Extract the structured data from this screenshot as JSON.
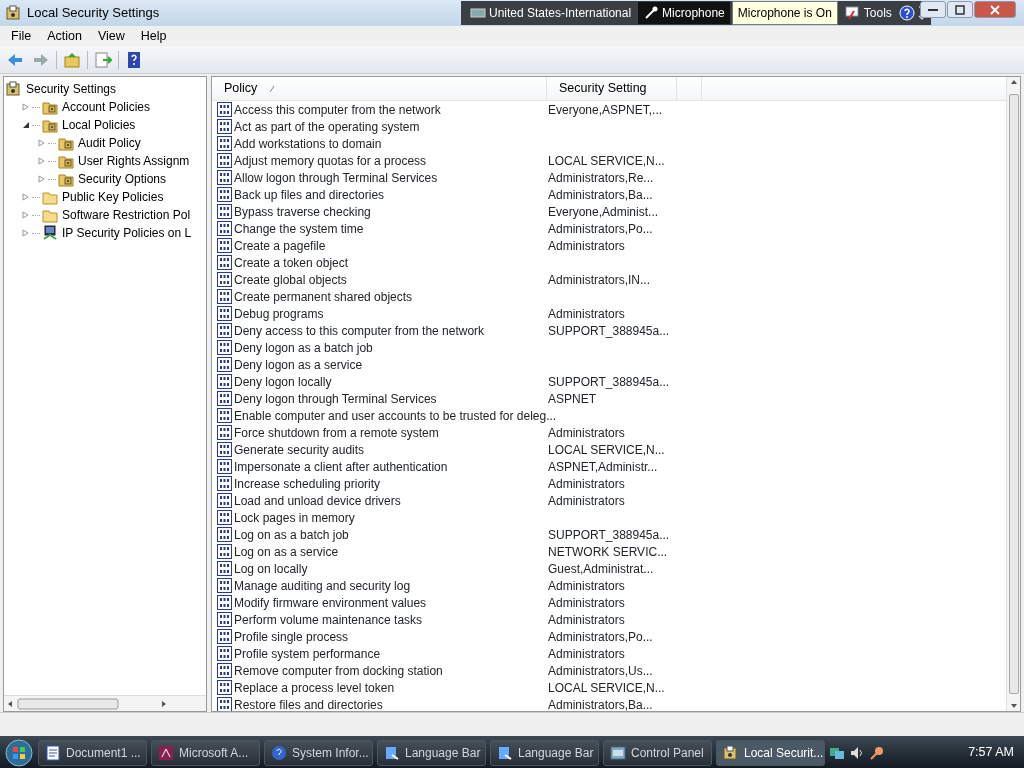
{
  "window": {
    "title": "Local Security Settings"
  },
  "language_bar": {
    "items": [
      {
        "label": "United States-International",
        "kind": "keyboard",
        "selected": false
      },
      {
        "label": "Microphone",
        "kind": "microphone",
        "selected": true
      },
      {
        "label": "Tools",
        "kind": "tools",
        "selected": false
      }
    ],
    "tooltip": "Microphone is On"
  },
  "menu": [
    "File",
    "Action",
    "View",
    "Help"
  ],
  "tree": [
    {
      "label": "Security Settings",
      "kind": "root",
      "children": [
        {
          "label": "Account Policies",
          "kind": "policy-folder",
          "expanded": false
        },
        {
          "label": "Local Policies",
          "kind": "policy-folder",
          "expanded": true,
          "children": [
            {
              "label": "Audit Policy",
              "kind": "policy-folder",
              "expanded": false
            },
            {
              "label": "User Rights Assignm",
              "kind": "policy-folder",
              "expanded": false
            },
            {
              "label": "Security Options",
              "kind": "policy-folder",
              "expanded": false
            }
          ]
        },
        {
          "label": "Public Key Policies",
          "kind": "folder",
          "expanded": false
        },
        {
          "label": "Software Restriction Pol",
          "kind": "folder",
          "expanded": false
        },
        {
          "label": "IP Security Policies on L",
          "kind": "network",
          "expanded": false
        }
      ]
    }
  ],
  "table": {
    "columns": [
      "Policy",
      "Security Setting"
    ],
    "rows": [
      [
        "Access this computer from the network",
        "Everyone,ASPNET,..."
      ],
      [
        "Act as part of the operating system",
        ""
      ],
      [
        "Add workstations to domain",
        ""
      ],
      [
        "Adjust memory quotas for a process",
        "LOCAL SERVICE,N..."
      ],
      [
        "Allow logon through Terminal Services",
        "Administrators,Re..."
      ],
      [
        "Back up files and directories",
        "Administrators,Ba..."
      ],
      [
        "Bypass traverse checking",
        "Everyone,Administ..."
      ],
      [
        "Change the system time",
        "Administrators,Po..."
      ],
      [
        "Create a pagefile",
        "Administrators"
      ],
      [
        "Create a token object",
        ""
      ],
      [
        "Create global objects",
        "Administrators,IN..."
      ],
      [
        "Create permanent shared objects",
        ""
      ],
      [
        "Debug programs",
        "Administrators"
      ],
      [
        "Deny access to this computer from the network",
        "SUPPORT_388945a..."
      ],
      [
        "Deny logon as a batch job",
        ""
      ],
      [
        "Deny logon as a service",
        ""
      ],
      [
        "Deny logon locally",
        "SUPPORT_388945a..."
      ],
      [
        "Deny logon through Terminal Services",
        "ASPNET"
      ],
      [
        "Enable computer and user accounts to be trusted for deleg...",
        ""
      ],
      [
        "Force shutdown from a remote system",
        "Administrators"
      ],
      [
        "Generate security audits",
        "LOCAL SERVICE,N..."
      ],
      [
        "Impersonate a client after authentication",
        "ASPNET,Administr..."
      ],
      [
        "Increase scheduling priority",
        "Administrators"
      ],
      [
        "Load and unload device drivers",
        "Administrators"
      ],
      [
        "Lock pages in memory",
        ""
      ],
      [
        "Log on as a batch job",
        "SUPPORT_388945a..."
      ],
      [
        "Log on as a service",
        "NETWORK SERVIC..."
      ],
      [
        "Log on locally",
        "Guest,Administrat..."
      ],
      [
        "Manage auditing and security log",
        "Administrators"
      ],
      [
        "Modify firmware environment values",
        "Administrators"
      ],
      [
        "Perform volume maintenance tasks",
        "Administrators"
      ],
      [
        "Profile single process",
        "Administrators,Po..."
      ],
      [
        "Profile system performance",
        "Administrators"
      ],
      [
        "Remove computer from docking station",
        "Administrators,Us..."
      ],
      [
        "Replace a process level token",
        "LOCAL SERVICE,N..."
      ],
      [
        "Restore files and directories",
        "Administrators,Ba..."
      ]
    ]
  },
  "taskbar": {
    "items": [
      {
        "label": "Document1 ...",
        "kind": "word",
        "selected": false
      },
      {
        "label": "Microsoft A...",
        "kind": "access",
        "selected": false
      },
      {
        "label": "System Infor...",
        "kind": "help",
        "selected": false
      },
      {
        "label": "Language Bar",
        "kind": "langbar",
        "selected": false
      },
      {
        "label": "Language Bar",
        "kind": "langbar",
        "selected": false
      },
      {
        "label": "Control Panel",
        "kind": "panel",
        "selected": false
      },
      {
        "label": "Local Securit...",
        "kind": "security",
        "selected": true
      }
    ],
    "clock": "7:57 AM"
  }
}
